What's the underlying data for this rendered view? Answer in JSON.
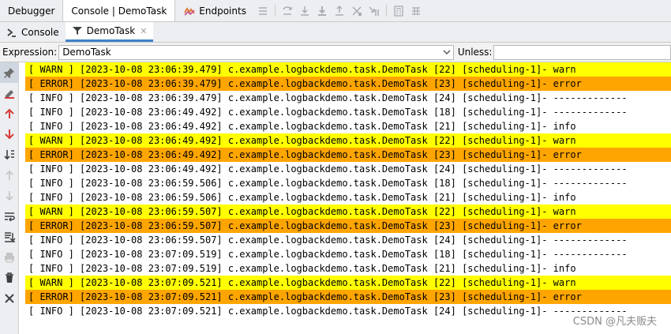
{
  "tabs": [
    {
      "label": "Debugger"
    },
    {
      "label": "Console | DemoTask"
    },
    {
      "label": "Endpoints"
    }
  ],
  "subtabs": [
    {
      "label": "Console"
    },
    {
      "label": "DemoTask"
    }
  ],
  "filter": {
    "expression_label": "Expression:",
    "expression_value": "DemoTask",
    "unless_label": "Unless:",
    "unless_value": ""
  },
  "colors": {
    "warn": "#ffff00",
    "error": "#ffa500",
    "accent": "#4083c9"
  },
  "log": [
    {
      "level": "warn",
      "text": "[ WARN ] [2023-10-08 23:06:39.479] c.example.logbackdemo.task.DemoTask [22] [scheduling-1]- warn"
    },
    {
      "level": "error",
      "text": "[ ERROR] [2023-10-08 23:06:39.479] c.example.logbackdemo.task.DemoTask [23] [scheduling-1]- error"
    },
    {
      "level": "info",
      "text": "[ INFO ] [2023-10-08 23:06:39.479] c.example.logbackdemo.task.DemoTask [24] [scheduling-1]- -------------"
    },
    {
      "level": "info",
      "text": "[ INFO ] [2023-10-08 23:06:49.492] c.example.logbackdemo.task.DemoTask [18] [scheduling-1]- -------------"
    },
    {
      "level": "info",
      "text": "[ INFO ] [2023-10-08 23:06:49.492] c.example.logbackdemo.task.DemoTask [21] [scheduling-1]- info"
    },
    {
      "level": "warn",
      "text": "[ WARN ] [2023-10-08 23:06:49.492] c.example.logbackdemo.task.DemoTask [22] [scheduling-1]- warn"
    },
    {
      "level": "error",
      "text": "[ ERROR] [2023-10-08 23:06:49.492] c.example.logbackdemo.task.DemoTask [23] [scheduling-1]- error"
    },
    {
      "level": "info",
      "text": "[ INFO ] [2023-10-08 23:06:49.492] c.example.logbackdemo.task.DemoTask [24] [scheduling-1]- -------------"
    },
    {
      "level": "info",
      "text": "[ INFO ] [2023-10-08 23:06:59.506] c.example.logbackdemo.task.DemoTask [18] [scheduling-1]- -------------"
    },
    {
      "level": "info",
      "text": "[ INFO ] [2023-10-08 23:06:59.506] c.example.logbackdemo.task.DemoTask [21] [scheduling-1]- info"
    },
    {
      "level": "warn",
      "text": "[ WARN ] [2023-10-08 23:06:59.507] c.example.logbackdemo.task.DemoTask [22] [scheduling-1]- warn"
    },
    {
      "level": "error",
      "text": "[ ERROR] [2023-10-08 23:06:59.507] c.example.logbackdemo.task.DemoTask [23] [scheduling-1]- error"
    },
    {
      "level": "info",
      "text": "[ INFO ] [2023-10-08 23:06:59.507] c.example.logbackdemo.task.DemoTask [24] [scheduling-1]- -------------"
    },
    {
      "level": "info",
      "text": "[ INFO ] [2023-10-08 23:07:09.519] c.example.logbackdemo.task.DemoTask [18] [scheduling-1]- -------------"
    },
    {
      "level": "info",
      "text": "[ INFO ] [2023-10-08 23:07:09.519] c.example.logbackdemo.task.DemoTask [21] [scheduling-1]- info"
    },
    {
      "level": "warn",
      "text": "[ WARN ] [2023-10-08 23:07:09.521] c.example.logbackdemo.task.DemoTask [22] [scheduling-1]- warn"
    },
    {
      "level": "error",
      "text": "[ ERROR] [2023-10-08 23:07:09.521] c.example.logbackdemo.task.DemoTask [23] [scheduling-1]- error"
    },
    {
      "level": "info",
      "text": "[ INFO ] [2023-10-08 23:07:09.521] c.example.logbackdemo.task.DemoTask [24] [scheduling-1]- -------------"
    }
  ],
  "watermark": "CSDN @凡夫贩夫"
}
